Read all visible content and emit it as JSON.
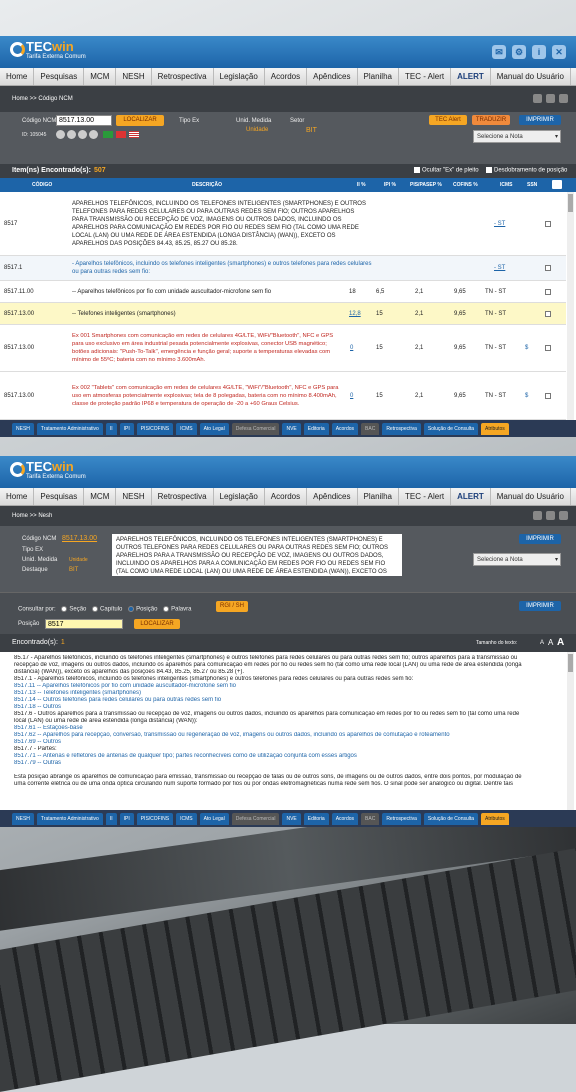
{
  "app": {
    "logo_tec": "TEC",
    "logo_win": "win",
    "tagline": "Tarifa Externa Comum"
  },
  "menu": [
    "Home",
    "Pesquisas",
    "MCM",
    "NESH",
    "Retrospectiva",
    "Legislação",
    "Acordos",
    "Apêndices",
    "Planilha",
    "TEC - Alert",
    "ALERT",
    "Manual do Usuário"
  ],
  "top_icons": [
    "mail-icon",
    "gear-icon",
    "info-icon",
    "close-icon"
  ],
  "ncm_screen": {
    "breadcrumb": "Home >> Código NCM",
    "code_label": "Código NCM",
    "code_value": "8517.13.00",
    "search_button": "LOCALIZAR",
    "id_label": "ID: 105045",
    "tipo_ex_label": "Tipo Ex",
    "unid_label": "Unid. Medida",
    "unid_value": "Unidade",
    "setor_label": "Setor",
    "setor_value": "BIT",
    "tec_alert_button": "TEC Alert",
    "traduzir_button": "TRADUZIR",
    "imprimir_button": "IMPRIMIR",
    "nota_select": "Selecione a Nota",
    "items_label": "Item(ns) Encontrado(s):",
    "items_count": "507",
    "ocultar_label": "Ocultar \"Ex\" de pleito",
    "desdobramento_label": "Desdobramento de posição",
    "columns": [
      "CÓDIGO",
      "DESCRIÇÃO",
      "II %",
      "IPI %",
      "PIS/PASEP %",
      "COFINS %",
      "ICMS",
      "SSN"
    ],
    "rows": [
      {
        "code": "8517",
        "desc": "APARELHOS TELEFÔNICOS, INCLUINDO OS TELEFONES INTELIGENTES (SMARTPHONES) E OUTROS TELEFONES PARA REDES CELULARES OU PARA OUTRAS REDES SEM FIO; OUTROS APARELHOS PARA TRANSMISSÃO OU RECEPÇÃO DE VOZ, IMAGENS OU OUTROS DADOS, INCLUINDO OS APARELHOS PARA COMUNICAÇÃO EM REDES POR FIO OU REDES SEM FIO (TAL COMO UMA REDE LOCAL (LAN) OU UMA REDE DE ÁREA ESTENDIDA (LONGA DISTÂNCIA) (WAN)), EXCETO OS APARELHOS DAS POSIÇÕES 84.43, 85.25, 85.27 OU 85.28.",
        "ii": "",
        "ipi": "",
        "pis": "",
        "cofins": "",
        "icms": "- ST",
        "ssn": ""
      },
      {
        "code": "8517.1",
        "desc": "- Aparelhos telefônicos, incluindo os telefones inteligentes (smartphones) e outros telefones para redes celulares ou para outras redes sem fio:",
        "ii": "",
        "ipi": "",
        "pis": "",
        "cofins": "",
        "icms": "- ST",
        "ssn": ""
      },
      {
        "code": "8517.11.00",
        "desc": "-- Aparelhos telefônicos por fio com unidade auscultador-microfone sem fio",
        "ii": "18",
        "ipi": "6,5",
        "pis": "2,1",
        "cofins": "9,65",
        "icms": "TN - ST",
        "ssn": ""
      },
      {
        "code": "8517.13.00",
        "desc": "-- Telefones inteligentes (smartphones)",
        "ii": "12,8",
        "ipi": "15",
        "pis": "2,1",
        "cofins": "9,65",
        "icms": "TN - ST",
        "ssn": ""
      },
      {
        "code": "8517.13.00",
        "desc": "Ex 001 Smartphones com comunicação em redes de celulares 4G/LTE, WiFi/\"Bluetooth\", NFC e GPS para uso exclusivo em área industrial pesada potencialmente explosivas, conector USB magnético; botões adicionais: \"Push-To-Talk\", emergência e função geral; suporte a temperaturas elevadas com mínimo de 55ºC; bateria com no mínimo 3.600mAh.",
        "ii": "0",
        "ipi": "15",
        "pis": "2,1",
        "cofins": "9,65",
        "icms": "TN - ST",
        "ssn": "$"
      },
      {
        "code": "8517.13.00",
        "desc": "Ex 002 \"Tablets\" com comunicação em redes de celulares 4G/LTE, \"WiFi\"/\"Bluetooth\", NFC e GPS para uso em atmosferas potencialmente explosivas; tela de 8 polegadas, bateria com no mínimo 8.400mAh, classe de proteção padrão IP68 e temperatura de operação de -20 a +60 Graus Celsius.",
        "ii": "0",
        "ipi": "15",
        "pis": "2,1",
        "cofins": "9,65",
        "icms": "TN - ST",
        "ssn": "$"
      }
    ]
  },
  "tabs": [
    "NESH",
    "Tratamento Administrativo",
    "II",
    "IPI",
    "PIS/COFINS",
    "ICMS",
    "Ato Legal",
    "Defesa Comercial",
    "NVE",
    "Editoria",
    "Acordos",
    "BAC",
    "Retrospectiva",
    "Solução de Consulta",
    "Atributos"
  ],
  "nesh_screen": {
    "breadcrumb": "Home >> Nesh",
    "code_label": "Código NCM",
    "code_value": "8517.13.00",
    "tipo_ex_label": "Tipo EX",
    "unid_label": "Unid. Medida",
    "unid_value": "Unidade",
    "destaque_label": "Destaque",
    "destaque_value": "BIT",
    "desc_text": "APARELHOS TELEFÔNICOS, INCLUINDO OS TELEFONES INTELIGENTES (SMARTPHONES) E OUTROS TELEFONES PARA REDES CELULARES OU PARA OUTRAS REDES SEM FIO; OUTROS APARELHOS PARA A TRANSMISSÃO OU RECEPÇÃO DE VOZ, IMAGENS OU OUTROS DADOS, INCLUINDO OS APARELHOS PARA A COMUNICAÇÃO EM REDES POR FIO OU REDES SEM FIO (TAL COMO UMA REDE LOCAL (LAN) OU UMA REDE DE ÁREA ESTENDIDA (WAN)), EXCETO OS APARELHOS DAS POSIÇÕES 84.43, 85.25, 85.27 OU 85.28.",
    "imprimir_button": "IMPRIMIR",
    "nota_select": "Selecione a Nota",
    "consultar_label": "Consultar por:",
    "options": [
      "Seção",
      "Capítulo",
      "Posição",
      "Palavra"
    ],
    "selected_option": "Posição",
    "rgi_button": "RGI / SH",
    "posicao_label": "Posição",
    "posicao_value": "8517",
    "search_button": "LOCALIZAR",
    "imprimir2_button": "IMPRIMIR",
    "found_label": "Encontrado(s):",
    "found_count": "1",
    "text_size_label": "Tamanho do texto:",
    "text_size_options": [
      "A",
      "A",
      "A"
    ],
    "lines": [
      "85.17 - Aparelhos telefônicos, incluindo os telefones inteligentes (smartphones) e outros telefones para redes celulares ou para outras redes sem fio; outros aparelhos para a transmissão ou",
      "recepção de voz, imagens ou outros dados, incluindo os aparelhos para comunicação em redes por fio ou redes sem fio (tal como uma rede local (LAN) ou uma rede de área estendida (longa",
      "distância) (WAN)), exceto os aparelhos das posições 84.43, 85.25, 85.27 ou 85.28 (+).",
      "8517.1 - Aparelhos telefônicos, incluindo os telefones inteligentes (smartphones) e outros telefones para redes celulares ou para outras redes sem fio:",
      "8517.11 -- Aparelhos telefônicos por fio com unidade auscultador-microfone sem fio",
      "8517.13 -- Telefones inteligentes (smartphones)",
      "8517.14 -- Outros telefones para redes celulares ou para outras redes sem fio",
      "8517.18 -- Outros",
      "8517.6 - Outros aparelhos para a transmissão ou recepção de voz, imagens ou outros dados, incluindo os aparelhos para comunicação em redes por fio ou redes sem fio (tal como uma rede",
      "local (LAN) ou uma rede de área estendida (longa distância) (WAN)):",
      "8517.61 -- Estações-base",
      "8517.62 -- Aparelhos para recepção, conversão, transmissão ou regeneração de voz, imagens ou outros dados, incluindo os aparelhos de comutação e roteamento",
      "8517.69 -- Outros",
      "8517.7 - Partes:",
      "8517.71 -- Antenas e refletores de antenas de qualquer tipo; partes reconhecíveis como de utilização conjunta com esses artigos",
      "8517.79 -- Outras",
      "",
      "Esta posição abrange os aparelhos de comunicação para emissão, transmissão ou recepção de falas ou de outros sons, de imagens ou de outros dados, entre dois pontos, por modulação de",
      "uma corrente elétrica ou de uma onda óptica circulando num suporte formado por fios ou por ondas eletromagnéticas numa rede sem fios. O sinal pode ser analógico ou digital. Dentre tais"
    ]
  }
}
